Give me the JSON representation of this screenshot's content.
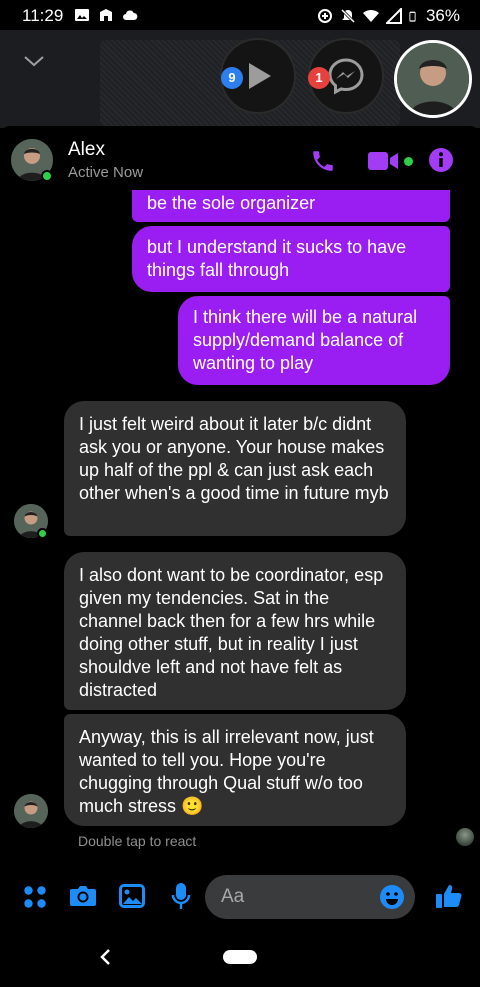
{
  "status_bar": {
    "time": "11:29",
    "battery": "36%"
  },
  "chat_heads": {
    "video_badge": "9",
    "messenger_badge": "1"
  },
  "header": {
    "name": "Alex",
    "status": "Active Now"
  },
  "messages": [
    {
      "from": "me",
      "text": "be the sole organizer"
    },
    {
      "from": "me",
      "text": "but I understand it sucks to have things fall through"
    },
    {
      "from": "me",
      "text": "I think there will be a natural supply/demand balance of wanting to play"
    },
    {
      "from": "alex",
      "text": "I just felt weird about it later b/c didnt ask you or anyone. Your house makes up half of the ppl & can just ask each other when's a good time in future myb"
    },
    {
      "from": "alex",
      "text": "I also dont want to be coordinator, esp given my tendencies. Sat in the channel back then for a few hrs while doing other stuff, but in reality I just shouldve left and not have felt as distracted"
    },
    {
      "from": "alex",
      "text": "Anyway, this is all irrelevant now, just wanted to tell you. Hope you're chugging through Qual stuff w/o too much stress 🙂"
    }
  ],
  "react_hint": "Double tap to react",
  "composer": {
    "placeholder": "Aa"
  },
  "colors": {
    "outgoing_bubble": "#9a1ef2",
    "incoming_bubble": "#303030",
    "accent_purple": "#a33cf5",
    "accent_blue": "#1d8cf8",
    "online_green": "#2fcf48"
  }
}
